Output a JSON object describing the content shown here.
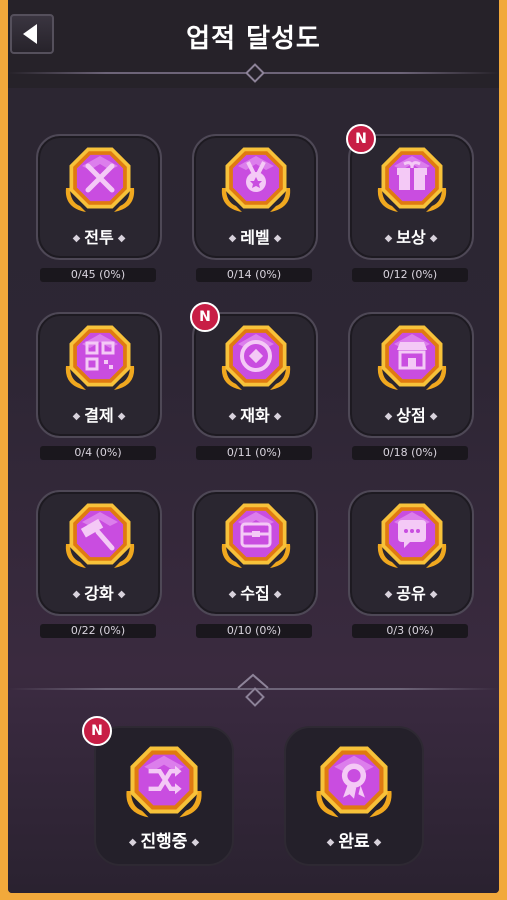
{
  "header": {
    "title": "업적 달성도"
  },
  "categories": [
    {
      "label": "전투",
      "progress": "0/45 (0%)",
      "icon": "crossed-swords-icon",
      "new": false
    },
    {
      "label": "레벨",
      "progress": "0/14 (0%)",
      "icon": "medal-icon",
      "new": false
    },
    {
      "label": "보상",
      "progress": "0/12 (0%)",
      "icon": "gift-box-icon",
      "new": true
    },
    {
      "label": "결제",
      "progress": "0/4 (0%)",
      "icon": "qr-code-icon",
      "new": false
    },
    {
      "label": "재화",
      "progress": "0/11 (0%)",
      "icon": "coin-icon",
      "new": true
    },
    {
      "label": "상점",
      "progress": "0/18 (0%)",
      "icon": "shop-icon",
      "new": false
    },
    {
      "label": "강화",
      "progress": "0/22 (0%)",
      "icon": "hammer-icon",
      "new": false
    },
    {
      "label": "수집",
      "progress": "0/10 (0%)",
      "icon": "chest-icon",
      "new": false
    },
    {
      "label": "공유",
      "progress": "0/3 (0%)",
      "icon": "chat-bubble-icon",
      "new": false
    }
  ],
  "bottom_tabs": [
    {
      "label": "진행중",
      "icon": "shuffle-icon",
      "new": true
    },
    {
      "label": "완료",
      "icon": "ribbon-award-icon",
      "new": false
    }
  ],
  "new_badge": "N",
  "colors": {
    "gem": "#c94de0",
    "gold": "#f0a81f",
    "new": "#c81e45",
    "frame": "#f2a93b"
  }
}
